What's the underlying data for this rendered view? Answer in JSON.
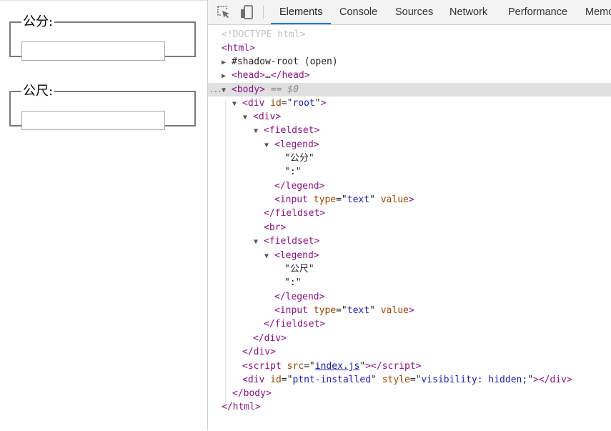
{
  "page": {
    "fieldsets": [
      {
        "legend": "公分:",
        "value": ""
      },
      {
        "legend": "公尺:",
        "value": ""
      }
    ]
  },
  "devtools": {
    "tabs": [
      "Elements",
      "Console",
      "Sources",
      "Network",
      "Performance",
      "Memo"
    ],
    "active_tab": "Elements",
    "icons": [
      "inspect-element-icon",
      "device-toolbar-icon"
    ],
    "selected_marker": "== $0",
    "dots": "...",
    "tree": {
      "doctype": "<!DOCTYPE html>",
      "html_open": "html",
      "shadow_root": "#shadow-root (open)",
      "head": "head",
      "ellipsis": "…",
      "body": "body",
      "div_root": {
        "tag": "div",
        "attr": "id",
        "val": "root"
      },
      "div": "div",
      "fieldset": "fieldset",
      "legend": "legend",
      "text1a": "\"公分\"",
      "text1b": "\":\"",
      "input": {
        "tag": "input",
        "attr1": "type",
        "val1": "text",
        "attr2": "value"
      },
      "br": "br",
      "text2a": "\"公尺\"",
      "text2b": "\":\"",
      "script": {
        "tag": "script",
        "attr": "src",
        "val": "index.js"
      },
      "ptnt": {
        "tag": "div",
        "attr1": "id",
        "val1": "ptnt-installed",
        "attr2": "style",
        "val2": "visibility: hidden;"
      }
    }
  }
}
